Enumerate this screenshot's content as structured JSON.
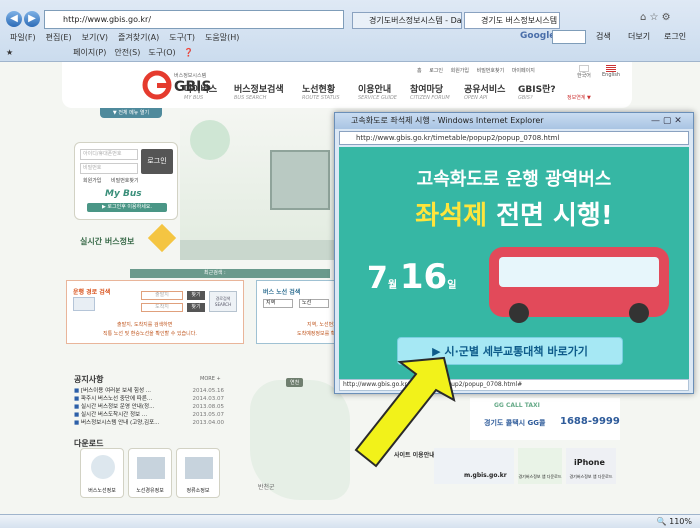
{
  "browser": {
    "address": "http://www.gbis.go.kr/",
    "tabs": [
      "경기도버스정보시스템 - Dau...",
      "경기도 버스정보시스템"
    ],
    "search_engine": "Google",
    "search_label": "검색",
    "more_label": "더보기",
    "login_label": "로그인",
    "menu": [
      "파일(F)",
      "편집(E)",
      "보기(V)",
      "즐겨찾기(A)",
      "도구(T)",
      "도움말(H)"
    ],
    "toolbar": [
      "페이지(P)",
      "안전(S)",
      "도구(O)"
    ],
    "status_zoom": "110%"
  },
  "site": {
    "logo_text": "GBIS",
    "logo_subtitle": "버스정보시스템",
    "top_links": [
      "홈",
      "로그인",
      "회원가입",
      "비밀번호찾기",
      "마이페이지",
      "한국어",
      "English"
    ],
    "nav": [
      {
        "label": "마이버스",
        "sub": "MY BUS"
      },
      {
        "label": "버스정보검색",
        "sub": "BUS SEARCH"
      },
      {
        "label": "노선현황",
        "sub": "ROUTE STATUS"
      },
      {
        "label": "이용안내",
        "sub": "SERVICE GUIDE"
      },
      {
        "label": "참여마당",
        "sub": "CITIZEN FORUM"
      },
      {
        "label": "공유서비스",
        "sub": "OPEN API"
      },
      {
        "label": "GBIS란?",
        "sub": "GBIS?"
      }
    ],
    "service_link": "정보연계 ▼",
    "menu_open": "▼ 전체 메뉴 열기",
    "login": {
      "id_placeholder": "아이디/휴대폰번호",
      "pw_placeholder": "비밀번호",
      "button": "로그인",
      "signup": "회원가입",
      "find_pw": "비밀번호찾기"
    },
    "mybus": "My Bus",
    "mybus_hint": "▶ 로그인후 이용하세요.",
    "realtime": "실시간 버스정보",
    "recent": "최근검색 :",
    "route_search_title": "운행 경로 검색",
    "route_from": "출발지",
    "route_to": "도착지",
    "find_btn": "찾기",
    "route_search_btn": "경로검색 SEARCH",
    "route_hint1": "출발지, 도착지를 검색하면",
    "route_hint2": "직통 노선 및 환승노선을 확인할 수 있습니다.",
    "bus_route_title": "버스 노선 검색",
    "bus_route_select": "지역",
    "bus_route_select2": "노선",
    "bus_route_hint1": "지역, 노선번호를 검색하면",
    "bus_route_hint2": "도착예정정보를 확인할 수 있습니다.",
    "notice_title": "공지사항",
    "notice_more": "MORE +",
    "notices": [
      {
        "text": "[버스이용 여러분 보세 힘성 ...",
        "date": "2014.05.16"
      },
      {
        "text": "파주시 버스노선 중단에 따른...",
        "date": "2014.03.07"
      },
      {
        "text": "실시간 버스정보 운영 안내(정...",
        "date": "2013.08.05"
      },
      {
        "text": "실시간 버스도착시간 정보 ...",
        "date": "2013.05.07"
      },
      {
        "text": "버스정보시스템 안내 (고양,김포...",
        "date": "2013.04.00"
      }
    ],
    "download_title": "다운로드",
    "downloads": [
      "버스노선정보",
      "노선경유정보",
      "정류소정보"
    ],
    "map_label1": "연천",
    "map_label2": "반천군",
    "taxi_label": "경기도 콜택시 GG콜",
    "taxi_phone": "1688-9999",
    "taxi_en": "GG CALL TAXI",
    "site_label": "사이트 이용안내",
    "mobile_web": "m.gbis.go.kr",
    "apps": [
      "경기버스정보 앱 다운로드",
      "경기버스정보 앱 다운로드"
    ],
    "iphone": "iPhone"
  },
  "popup": {
    "title": "고속화도로 좌석제 시행 - Windows Internet Explorer",
    "url": "http://www.gbis.go.kr/timetable/popup2/popup_0708.html",
    "line1": "고속화도로 운행 광역버스",
    "line2a": "좌석제",
    "line2b": " 전면 시행!",
    "month": "7",
    "month_unit": "월",
    "day": "16",
    "day_unit": "일",
    "button": "▶ 시·군별 세부교통대책 바로가기",
    "status_url": "http://www.gbis.go.kr/timetable/popup2/popup_0708.html#"
  },
  "colors": {
    "accent": "#2e9a8a",
    "poster_bg": "#36b7a4",
    "highlight": "#ffe53b",
    "bus": "#e24a5a",
    "arrow": "#f2f21a"
  }
}
